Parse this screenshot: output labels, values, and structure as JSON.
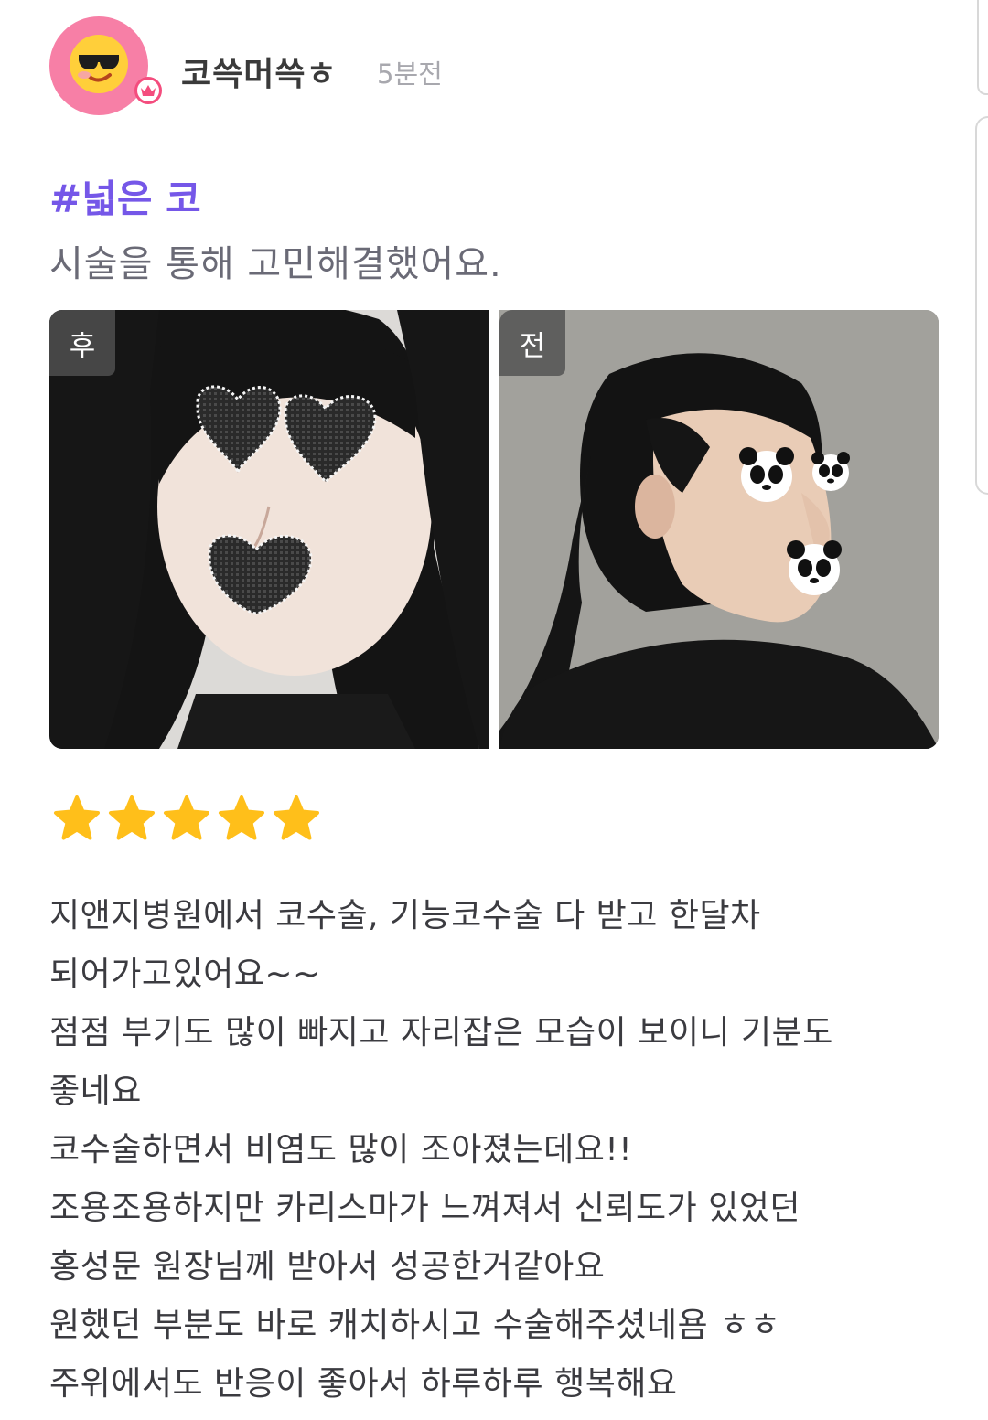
{
  "post": {
    "username": "코쓱머쓱ㅎ",
    "time": "5분전",
    "hashtag": "#넓은 코",
    "subtitle": "시술을 통해 고민해결했어요."
  },
  "photos": [
    {
      "tag": "후",
      "icon": "heart-sticker-icon"
    },
    {
      "tag": "전",
      "icon": "panda-sticker-icon"
    }
  ],
  "rating": {
    "value": 5,
    "max": 5,
    "color": "#ffbf1a"
  },
  "review": {
    "lines": [
      "지앤지병원에서 코수술, 기능코수술 다 받고 한달차",
      "되어가고있어요~~",
      "점점 부기도 많이 빠지고 자리잡은 모습이 보이니 기분도",
      "좋네요",
      "코수술하면서 비염도 많이 조아졌는데요!!",
      "조용조용하지만 카리스마가 느껴져서 신뢰도가 있었던",
      "홍성문 원장님께 받아서 성공한거같아요",
      "원했던 부분도 바로 캐치하시고 수술해주셨네욤 ㅎㅎ",
      "주위에서도 반응이 좋아서 하루하루 행복해요"
    ]
  },
  "colors": {
    "accent": "#7557e8",
    "avatar_bg": "#f77fa6",
    "badge": "#f44d7e"
  }
}
